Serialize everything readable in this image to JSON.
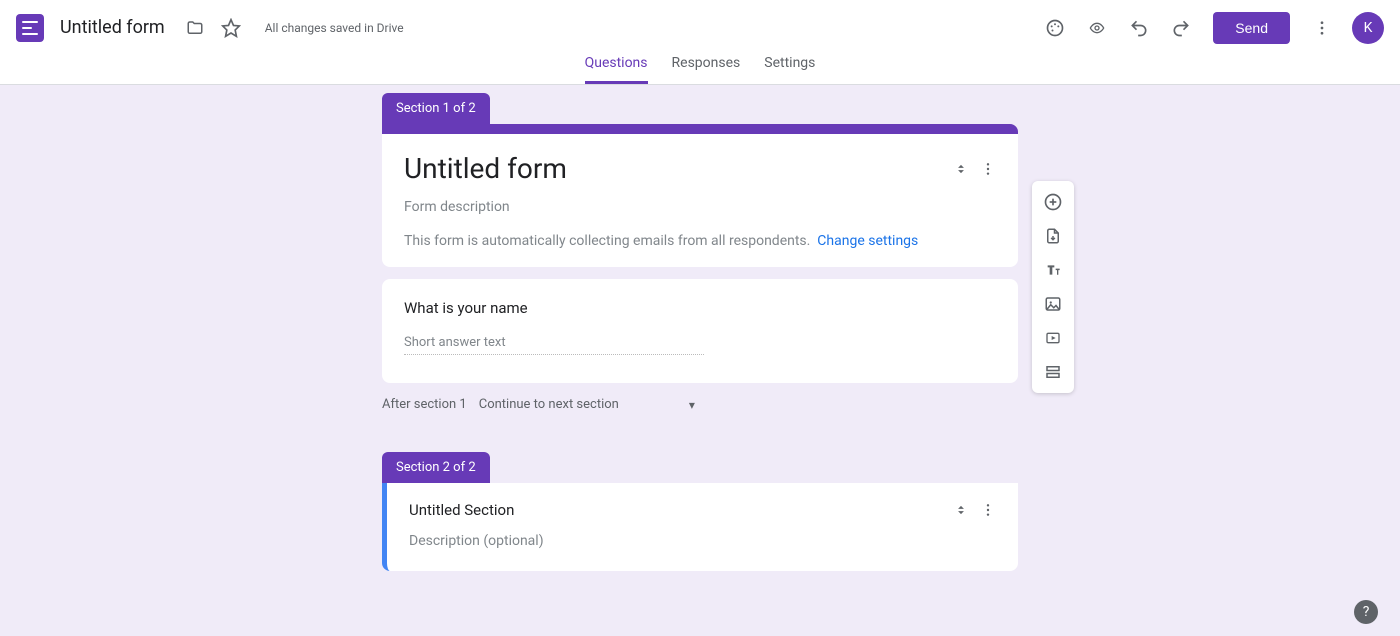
{
  "header": {
    "form_name": "Untitled form",
    "save_status": "All changes saved in Drive",
    "send_label": "Send",
    "avatar_letter": "K"
  },
  "tabs": {
    "questions": "Questions",
    "responses": "Responses",
    "settings": "Settings"
  },
  "section1": {
    "tab_label": "Section 1 of 2",
    "title": "Untitled form",
    "description_placeholder": "Form description",
    "collecting_text": "This form is automatically collecting emails from all respondents.",
    "change_link": "Change settings"
  },
  "question1": {
    "text": "What is your name",
    "answer_placeholder": "Short answer text"
  },
  "after_section": {
    "label": "After section 1",
    "value": "Continue to next section"
  },
  "section2": {
    "tab_label": "Section 2 of 2",
    "title": "Untitled Section",
    "description_placeholder": "Description (optional)"
  },
  "toolbar_icons": {
    "add_question": "add-question",
    "import_questions": "import-questions",
    "add_title": "add-title-description",
    "add_image": "add-image",
    "add_video": "add-video",
    "add_section": "add-section"
  }
}
